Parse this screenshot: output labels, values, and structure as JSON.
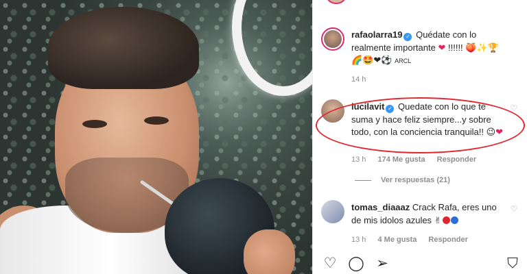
{
  "post": {
    "photo_description_icon": "photo-icon"
  },
  "caption": {
    "username": "rafaolarra19",
    "text_line1": "Quédate con lo",
    "text_line2": "realmente importante",
    "tail1": "!!!!!!",
    "line3": "🌈🤩❤⚽",
    "tag": "ARCL",
    "time": "14 h"
  },
  "comments": [
    {
      "username": "lucilavit",
      "text": "Quedate con lo que te suma y hace feliz siempre...y sobre todo, con la conciencia tranquila!!",
      "time": "13 h",
      "likes": "174 Me gusta",
      "reply": "Responder",
      "view_replies": "Ver respuestas (21)"
    },
    {
      "username": "tomas_diaaaz",
      "text": "Crack Rafa, eres uno de mis idolos azules",
      "time": "13 h",
      "likes": "4 Me gusta",
      "reply": "Responder"
    }
  ],
  "colors": {
    "highlight": "#e3262f",
    "verified": "#3897f0",
    "muted": "#8e8e8e"
  }
}
